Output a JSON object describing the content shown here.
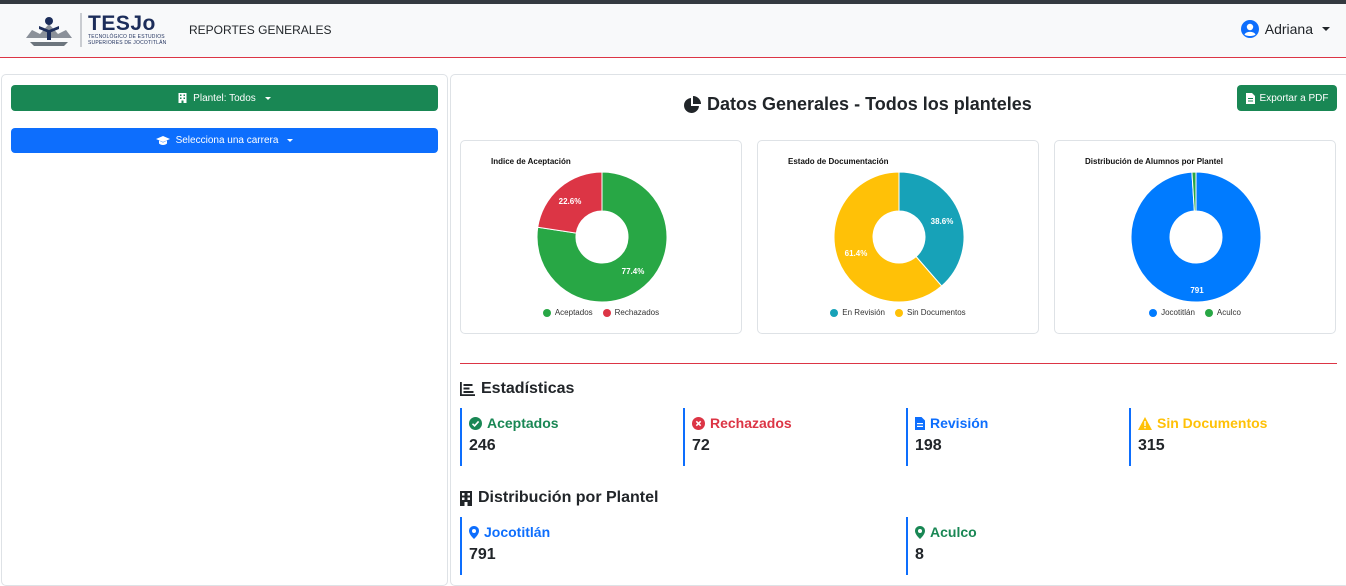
{
  "navbar": {
    "logo_title": "TESJo",
    "logo_subtitle_1": "TECNOLÓGICO DE ESTUDIOS",
    "logo_subtitle_2": "SUPERIORES DE JOCOTITLÁN",
    "title": "REPORTES GENERALES",
    "user_name": "Adriana"
  },
  "sidebar": {
    "plantel_label": "Plantel: Todos",
    "carrera_label": "Selecciona una carrera"
  },
  "main": {
    "title": "Datos Generales - Todos los planteles",
    "export_label": "Exportar a PDF"
  },
  "charts": {
    "acceptance": {
      "title": "Indice de Aceptación",
      "label_a": "77.4%",
      "label_b": "22.6%",
      "legend_a": "Aceptados",
      "legend_b": "Rechazados"
    },
    "docs": {
      "title": "Estado de Documentación",
      "label_a": "38.6%",
      "label_b": "61.4%",
      "legend_a": "En Revisión",
      "legend_b": "Sin Documentos"
    },
    "plantel": {
      "title": "Distribución de Alumnos por Plantel",
      "label_a": "791",
      "legend_a": "Jocotitlán",
      "legend_b": "Aculco"
    }
  },
  "chart_data": [
    {
      "type": "pie",
      "title": "Indice de Aceptación",
      "labels": [
        "Aceptados",
        "Rechazados"
      ],
      "values": [
        77.4,
        22.6
      ],
      "colors": [
        "#28a745",
        "#dc3545"
      ],
      "legend": "bottom"
    },
    {
      "type": "pie",
      "title": "Estado de Documentación",
      "labels": [
        "En Revisión",
        "Sin Documentos"
      ],
      "values": [
        38.6,
        61.4
      ],
      "colors": [
        "#17a2b8",
        "#ffc107"
      ],
      "legend": "bottom"
    },
    {
      "type": "pie",
      "title": "Distribución de Alumnos por Plantel",
      "labels": [
        "Jocotitlán",
        "Aculco"
      ],
      "values": [
        791,
        8
      ],
      "colors": [
        "#007bff",
        "#28a745"
      ],
      "legend": "bottom"
    }
  ],
  "stats": {
    "heading": "Estadísticas",
    "items": [
      {
        "label": "Aceptados",
        "value": "246",
        "color": "#198754"
      },
      {
        "label": "Rechazados",
        "value": "72",
        "color": "#dc3545"
      },
      {
        "label": "Revisión",
        "value": "198",
        "color": "#0d6efd"
      },
      {
        "label": "Sin Documentos",
        "value": "315",
        "color": "#ffc107"
      }
    ]
  },
  "planteles": {
    "heading": "Distribución por Plantel",
    "items": [
      {
        "label": "Jocotitlán",
        "value": "791",
        "color": "#0d6efd"
      },
      {
        "label": "Aculco",
        "value": "8",
        "color": "#198754"
      }
    ]
  }
}
